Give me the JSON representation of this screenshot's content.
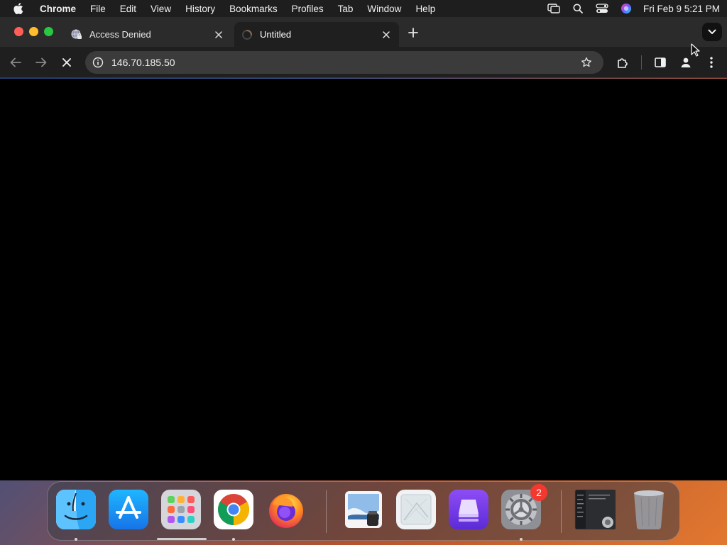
{
  "menubar": {
    "app_name": "Chrome",
    "items": [
      "File",
      "Edit",
      "View",
      "History",
      "Bookmarks",
      "Profiles",
      "Tab",
      "Window",
      "Help"
    ],
    "clock": "Fri Feb 9  5:21 PM"
  },
  "tabs": [
    {
      "title": "Access Denied",
      "favicon": "globe-lock-icon",
      "active": false
    },
    {
      "title": "Untitled",
      "favicon": "loading-spinner-icon",
      "active": true
    }
  ],
  "toolbar": {
    "url": "146.70.185.50",
    "loading": true
  },
  "dock": {
    "apps": [
      "Finder",
      "App Store",
      "Launchpad",
      "Google Chrome",
      "Firefox",
      "Preview",
      "Image Capture",
      "Storage App",
      "System Settings",
      "Recent Window",
      "Trash"
    ],
    "settings_badge": "2"
  },
  "colors": {
    "menubar_bg": "#1e1e1e",
    "tabstrip_bg": "#2b2b2b",
    "toolbar_bg": "#1f1f1f",
    "omnibox_bg": "#3b3b3b",
    "content_bg": "#000000",
    "close_red": "#ff5f57",
    "minimize_yellow": "#febc2e",
    "zoom_green": "#28c840",
    "badge_red": "#f3392f"
  }
}
